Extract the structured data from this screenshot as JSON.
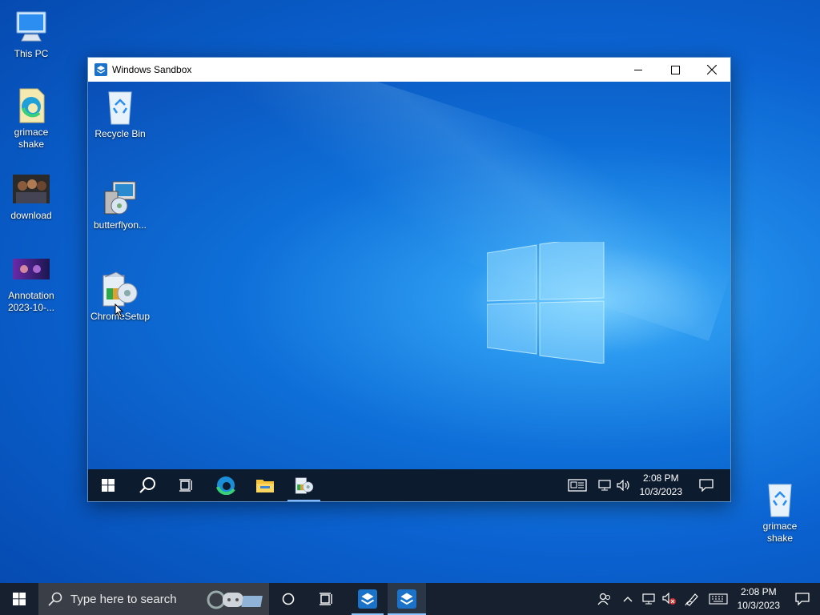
{
  "host_desktop": {
    "icons": [
      {
        "label": "This PC",
        "icon": "computer-icon"
      },
      {
        "label": "grimace shake",
        "icon": "edge-document-icon"
      },
      {
        "label": "download",
        "icon": "image-thumbnail-icon"
      },
      {
        "label": "Annotation 2023-10-...",
        "icon": "screenshot-thumbnail-icon"
      },
      {
        "label": "grimace shake",
        "icon": "recycle-bin-icon"
      }
    ]
  },
  "window": {
    "title": "Windows Sandbox",
    "controls": {
      "minimize": "minimize-icon",
      "maximize": "maximize-icon",
      "close": "close-icon"
    }
  },
  "sandbox": {
    "icons": [
      {
        "label": "Recycle Bin",
        "icon": "recycle-bin-icon"
      },
      {
        "label": "butterflyon...",
        "icon": "installer-icon"
      },
      {
        "label": "ChromeSetup",
        "icon": "setup-icon"
      }
    ],
    "taskbar": {
      "items": [
        "start-icon",
        "search-icon",
        "task-view-icon",
        "edge-icon",
        "file-explorer-icon",
        "setup-app-icon"
      ],
      "clock": {
        "time": "2:08 PM",
        "date": "10/3/2023"
      }
    }
  },
  "taskbar": {
    "search": {
      "placeholder": "Type here to search"
    },
    "clock": {
      "time": "2:08 PM",
      "date": "10/3/2023"
    },
    "apps": [
      "cortana-icon",
      "task-view-icon",
      "sandbox-app-icon",
      "sandbox-app-icon"
    ],
    "tray": [
      "people-icon",
      "chevron-up-icon",
      "network-icon",
      "volume-muted-icon",
      "pen-icon",
      "keyboard-icon",
      "notifications-icon"
    ]
  },
  "colors": {
    "accent": "#0078d7",
    "taskbar": "#16202e",
    "sandbox_taskbar": "#0d1b2e"
  }
}
